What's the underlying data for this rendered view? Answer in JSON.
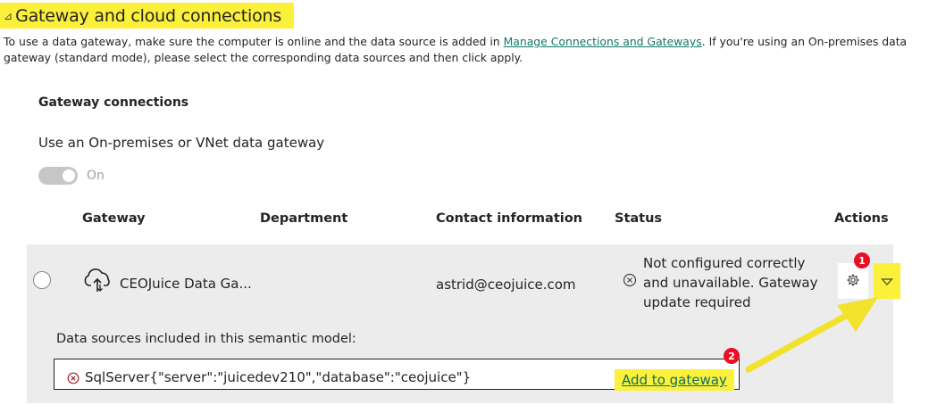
{
  "section": {
    "title": "Gateway and cloud connections",
    "collapse_glyph": "⊿"
  },
  "description": {
    "before_link": "To use a data gateway, make sure the computer is online and the data source is added in ",
    "link": "Manage Connections and Gateways",
    "after_link": ". If you're using an On-premises data gateway (standard mode), please select the corresponding data sources and then click apply."
  },
  "gateway_connections": {
    "title": "Gateway connections",
    "use_label": "Use an On-premises or VNet data gateway",
    "toggle_state": "On"
  },
  "table": {
    "headers": {
      "gateway": "Gateway",
      "department": "Department",
      "contact": "Contact information",
      "status": "Status",
      "actions": "Actions"
    },
    "row": {
      "gateway_name": "CEOJuice Data Ga...",
      "department": "",
      "contact": "astrid@ceojuice.com",
      "status": "Not configured correctly and unavailable. Gateway update required"
    }
  },
  "data_sources": {
    "label": "Data sources included in this semantic model:",
    "item": "SqlServer{\"server\":\"juicedev210\",\"database\":\"ceojuice\"}",
    "add_button": "Add to gateway"
  },
  "annotations": {
    "badge_1": "1",
    "badge_2": "2",
    "highlight_color": "#fbf03a",
    "badge_color": "#e81123"
  },
  "icons": {
    "gateway": "cloud-upload-icon",
    "status": "error-circle-icon",
    "settings": "gear-icon",
    "expand": "chevron-down-icon",
    "datasource_status": "error-circle-icon"
  }
}
